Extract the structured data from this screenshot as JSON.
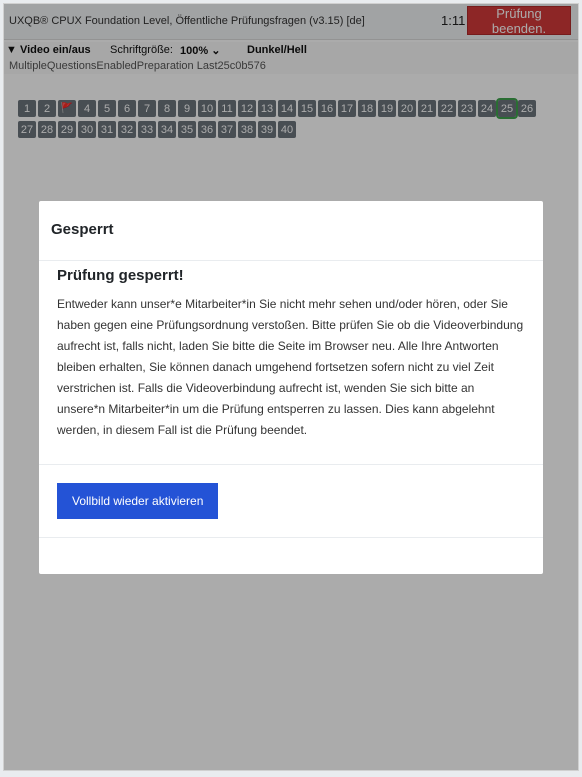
{
  "header": {
    "title": "UXQB® CPUX Foundation Level, Öffentliche Prüfungsfragen (v3.15) [de]",
    "timer": "1:11",
    "end_label": "Prüfung beenden."
  },
  "controls": {
    "video_toggle": "▼ Video ein/aus",
    "font_size_label": "Schriftgröße:",
    "font_size_value": "100% ⌄",
    "theme_toggle": "Dunkel/Hell",
    "mode": "MultipleQuestionsEnabledPreparation Last25c0b576"
  },
  "navigation": {
    "row1": [
      "1",
      "2",
      "🚩",
      "4",
      "5",
      "6",
      "7",
      "8",
      "9",
      "10",
      "11",
      "12",
      "13",
      "14",
      "15",
      "16",
      "17",
      "18",
      "19",
      "20",
      "21",
      "22",
      "23",
      "24",
      "25",
      "26"
    ],
    "row2": [
      "27",
      "28",
      "29",
      "30",
      "31",
      "32",
      "33",
      "34",
      "35",
      "36",
      "37",
      "38",
      "39",
      "40"
    ],
    "current": "25",
    "flagged": "3"
  },
  "modal": {
    "title": "Gesperrt",
    "heading": "Prüfung gesperrt!",
    "text": "Entweder kann unser*e Mitarbeiter*in Sie nicht mehr sehen und/oder hören, oder Sie haben gegen eine Prüfungsordnung verstoßen. Bitte prüfen Sie ob die Videoverbindung aufrecht ist, falls nicht, laden Sie bitte die Seite im Browser neu. Alle Ihre Antworten bleiben erhalten, Sie können danach umgehend fortsetzen sofern nicht zu viel Zeit verstrichen ist. Falls die Videoverbindung aufrecht ist, wenden Sie sich bitte an unsere*n Mitarbeiter*in um die Prüfung entsperren zu lassen. Dies kann abgelehnt werden, in diesem Fall ist die Prüfung beendet.",
    "button_label": "Vollbild wieder aktivieren"
  }
}
